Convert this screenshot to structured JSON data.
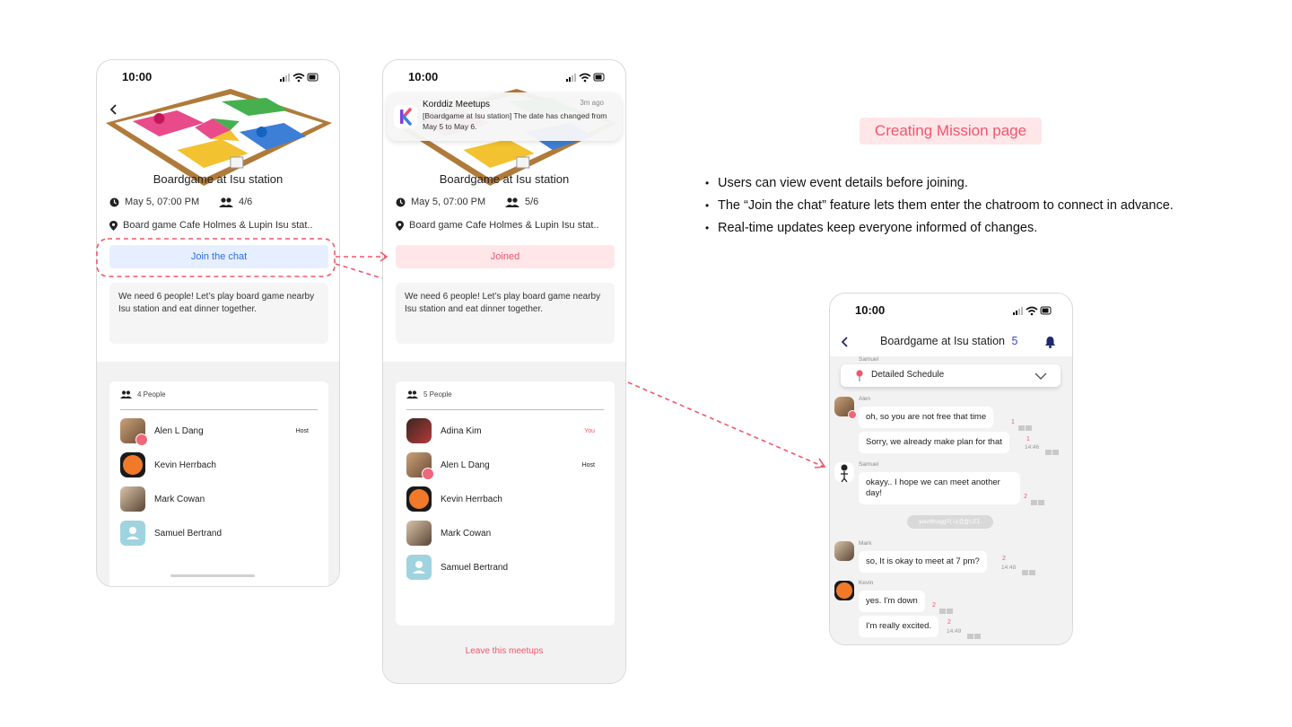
{
  "screen1": {
    "time": "10:00",
    "event_title": "Boardgame at Isu station",
    "date": "May 5, 07:00 PM",
    "count": "4/6",
    "location": "Board game Cafe Holmes & Lupin Isu stat..",
    "join_button": "Join the chat",
    "description": "We need 6 people! Let’s play board game nearby Isu station and eat dinner together.",
    "people_header": "4 People",
    "people": [
      {
        "name": "Alen  L Dang",
        "tag": "Host"
      },
      {
        "name": "Kevin Herrbach",
        "tag": ""
      },
      {
        "name": "Mark Cowan",
        "tag": ""
      },
      {
        "name": "Samuel Bertrand",
        "tag": ""
      }
    ]
  },
  "screen2": {
    "time": "10:00",
    "notification": {
      "app": "Korddiz Meetups",
      "time_ago": "3m ago",
      "text": "[Boardgame at Isu station] The date has changed from May 5 to May 6."
    },
    "event_title": "Boardgame at Isu station",
    "date": "May 5, 07:00 PM",
    "count": "5/6",
    "location": "Board game Cafe Holmes & Lupin Isu stat..",
    "joined_button": "Joined",
    "description": "We need 6 people! Let’s play board game nearby Isu station and eat dinner together.",
    "people_header": "5 People",
    "people": [
      {
        "name": "Adina Kim",
        "tag": "You"
      },
      {
        "name": "Alen  L Dang",
        "tag": "Host"
      },
      {
        "name": "Kevin Herrbach",
        "tag": ""
      },
      {
        "name": "Mark Cowan",
        "tag": ""
      },
      {
        "name": "Samuel Bertrand",
        "tag": ""
      }
    ],
    "leave_link": "Leave this meetups"
  },
  "info": {
    "heading": "Creating Mission page",
    "bullets": [
      "Users can view event details before joining.",
      "The “Join the chat” feature lets them enter the chatroom to connect in advance.",
      "Real-time updates keep everyone informed of changes."
    ]
  },
  "chat": {
    "time": "10:00",
    "title": "Boardgame at Isu station",
    "member_count": "5",
    "pinned": "Detailed Schedule",
    "partial_sender": "Samuel",
    "system_message": "younthugg이 나갔습니다.",
    "messages": [
      {
        "sender": "Alen",
        "text": "oh, so you are not free that time",
        "unread": "1",
        "time": ""
      },
      {
        "sender": "",
        "text": "Sorry, we already make plan for that",
        "unread": "1",
        "time": "14:46"
      },
      {
        "sender": "Samuel",
        "text": "okayy.. I hope we can meet another day!",
        "unread": "2",
        "time": ""
      },
      {
        "sender": "Mark",
        "text": "so, It is okay to meet at 7 pm?",
        "unread": "2",
        "time": "14:48"
      },
      {
        "sender": "Kevin",
        "text": "yes. I'm down",
        "unread": "2",
        "time": ""
      },
      {
        "sender": "",
        "text": "I'm really excited.",
        "unread": "2",
        "time": "14:49"
      }
    ]
  },
  "colors": {
    "accent_pink": "#f0566c",
    "join_blue_bg": "#e6efff",
    "join_blue_text": "#2f6ee0",
    "joined_pink_bg": "#ffe6e9",
    "nav_navy": "#1e2a6b"
  }
}
